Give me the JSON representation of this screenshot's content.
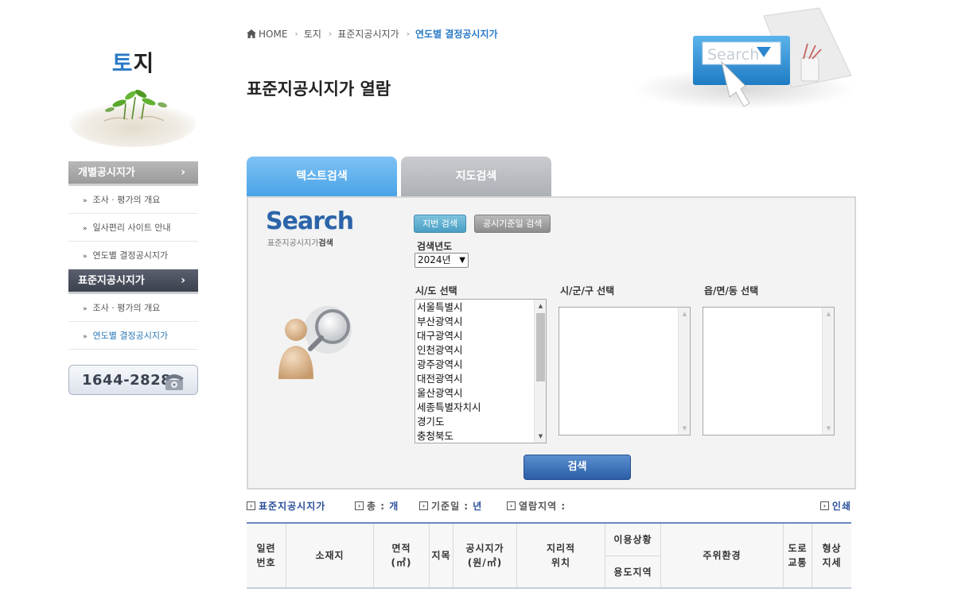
{
  "sidebar": {
    "title_accent": "토",
    "title_rest": "지",
    "sections": [
      {
        "label": "개별공시지가",
        "items": [
          "조사 · 평가의 개요",
          "일사편리 사이트 안내",
          "연도별 결정공시지가"
        ]
      },
      {
        "label": "표준지공시지가",
        "items": [
          "조사 · 평가의 개요",
          "연도별 결정공시지가"
        ]
      }
    ],
    "phone": "1644-2828"
  },
  "breadcrumb": [
    "HOME",
    "토지",
    "표준지공시지가",
    "연도별 결정공시지가"
  ],
  "page_title": "표준지공시지가 열람",
  "header_visual": {
    "search_word": "Search"
  },
  "tabs": [
    "텍스트검색",
    "지도검색"
  ],
  "search_panel": {
    "logo": "Search",
    "logo_sub_prefix": "표준지공시지가",
    "logo_sub_bold": "검색",
    "btn_lot": "지번 검색",
    "btn_date": "공시기준일 검색",
    "year_label": "검색년도",
    "year_value": "2024년",
    "sido_label": "시/도 선택",
    "sigungu_label": "시/군/구 선택",
    "dong_label": "읍/면/동 선택",
    "sido_options": [
      "서울특별시",
      "부산광역시",
      "대구광역시",
      "인천광역시",
      "광주광역시",
      "대전광역시",
      "울산광역시",
      "세종특별자치시",
      "경기도",
      "충청북도"
    ],
    "search_button": "검색"
  },
  "result_info": {
    "standard_label": "표준지공시지가",
    "total_label": "총 :",
    "total_unit": "개",
    "base_label": "기준일 :",
    "base_unit": "년",
    "region_label": "열람지역 :",
    "print_label": "인쇄"
  },
  "table": {
    "col_serial": [
      "일련",
      "번호"
    ],
    "col_location": "소재지",
    "col_area": [
      "면적",
      "(㎡)"
    ],
    "col_jimok": "지목",
    "col_price": [
      "공시지가",
      "(원/㎡)"
    ],
    "col_geo": [
      "지리적",
      "위치"
    ],
    "col_use_status": "이용상황",
    "col_zoning": "용도지역",
    "col_surround": "주위환경",
    "col_road": [
      "도로",
      "교통"
    ],
    "col_shape": [
      "형상",
      "지세"
    ]
  },
  "colors": {
    "accent": "#2a7ac7",
    "tab_active": "#49a3e6",
    "tab_inactive": "#adb0b6",
    "search_button": "#2b5ea6"
  }
}
